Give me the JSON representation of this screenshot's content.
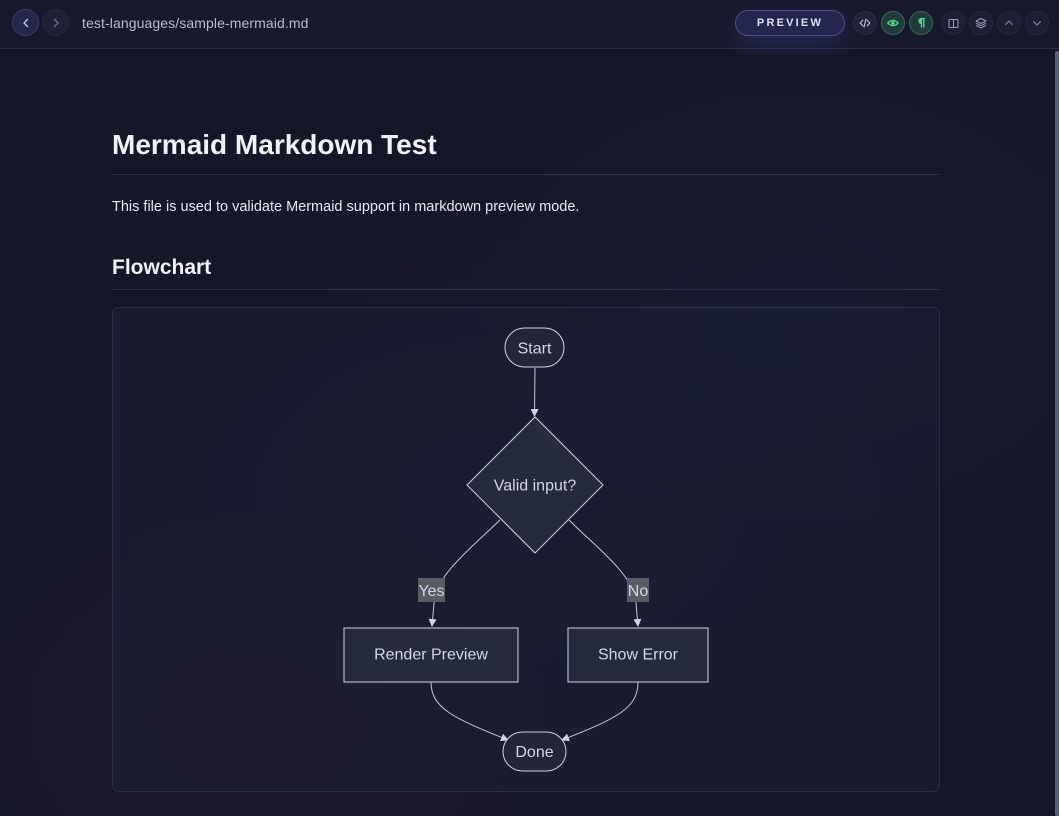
{
  "topbar": {
    "back_icon": "chevron-left-icon",
    "forward_icon": "chevron-right-icon",
    "file_path": "test-languages/sample-mermaid.md",
    "preview_label": "PREVIEW",
    "tools": [
      "code-icon",
      "eye-icon",
      "pilcrow-icon",
      "layout-icon",
      "layers-icon",
      "chevron-up-icon",
      "chevron-down-icon"
    ],
    "accent_color": "#4ade80"
  },
  "doc": {
    "title": "Mermaid Markdown Test",
    "intro": "This file is used to validate Mermaid support in markdown preview mode.",
    "section_title": "Flowchart"
  },
  "flowchart": {
    "nodes": {
      "start": "Start",
      "decision": "Valid input?",
      "render": "Render Preview",
      "error": "Show Error",
      "done": "Done"
    },
    "edges": {
      "yes": "Yes",
      "no": "No"
    }
  }
}
